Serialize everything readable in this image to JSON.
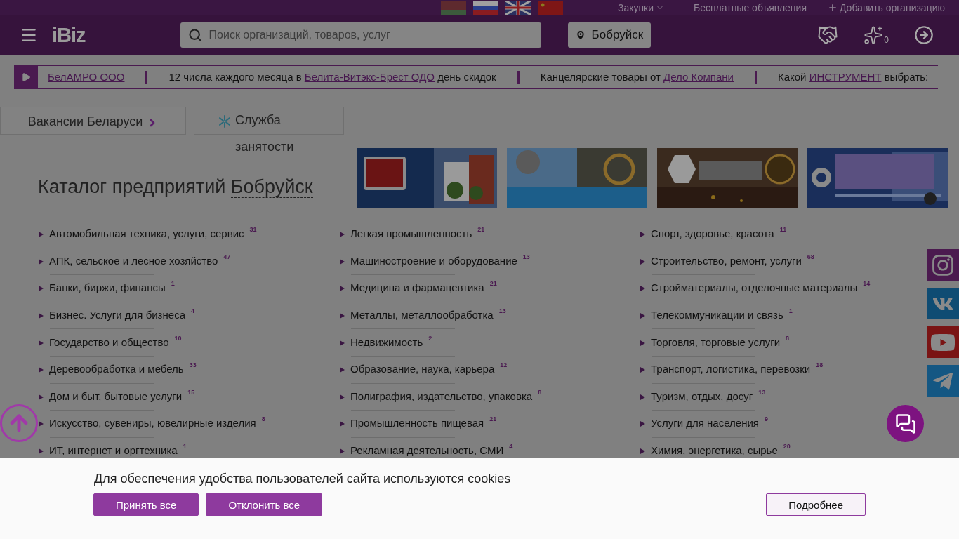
{
  "top_bar": {
    "links": [
      {
        "label": "Закупки",
        "kind": "dropdown"
      },
      {
        "label": "Бесплатные объявления",
        "kind": "link"
      },
      {
        "label": "Добавить организацию",
        "kind": "add"
      }
    ]
  },
  "header": {
    "logo": "iBiz",
    "search": {
      "placeholder": "Поиск организаций, товаров, услуг"
    },
    "city": "Бобруйск",
    "favorites_count": "0"
  },
  "ticker": {
    "items": [
      {
        "parts": [
          {
            "kind": "link",
            "text": "БелАМРО ООО"
          }
        ]
      },
      {
        "parts": [
          {
            "kind": "text",
            "text": "12 числа каждого месяца в "
          },
          {
            "kind": "link",
            "text": "Белита-Витэкс-Брест ОДО"
          },
          {
            "kind": "text",
            "text": " день скидок"
          }
        ]
      },
      {
        "parts": [
          {
            "kind": "text",
            "text": "Канцелярские товары от "
          },
          {
            "kind": "link",
            "text": "Дело Компани"
          }
        ]
      },
      {
        "parts": [
          {
            "kind": "text",
            "text": "Какой "
          },
          {
            "kind": "link",
            "text": "ИНСТРУМЕНТ"
          },
          {
            "kind": "text",
            "text": " выбрать:"
          }
        ]
      }
    ]
  },
  "promo_buttons": [
    {
      "label": "Вакансии Беларуси",
      "kind": "vacancies"
    },
    {
      "label": "Служба занятости",
      "kind": "employment"
    }
  ],
  "catalog": {
    "title": "Каталог предприятий",
    "city": "Бобруйск"
  },
  "categories": [
    [
      {
        "label": "Автомобильная техника, услуги, сервис",
        "count": "31"
      },
      {
        "label": "АПК, сельское и лесное хозяйство",
        "count": "47"
      },
      {
        "label": "Банки, биржи, финансы",
        "count": "1"
      },
      {
        "label": "Бизнес. Услуги для бизнеса",
        "count": "4"
      },
      {
        "label": "Государство и общество",
        "count": "10"
      },
      {
        "label": "Деревообработка и мебель",
        "count": "33"
      },
      {
        "label": "Дом и быт, бытовые услуги",
        "count": "15"
      },
      {
        "label": "Искусство, сувениры, ювелирные изделия",
        "count": "8"
      },
      {
        "label": "ИТ, интернет и оргтехника",
        "count": "1"
      }
    ],
    [
      {
        "label": "Легкая промышленность",
        "count": "21"
      },
      {
        "label": "Машиностроение и оборудование",
        "count": "13"
      },
      {
        "label": "Медицина и фармацевтика",
        "count": "21"
      },
      {
        "label": "Металлы, металлообработка",
        "count": "13"
      },
      {
        "label": "Недвижимость",
        "count": "2"
      },
      {
        "label": "Образование, наука, карьера",
        "count": "12"
      },
      {
        "label": "Полиграфия, издательство, упаковка",
        "count": "8"
      },
      {
        "label": "Промышленность пищевая",
        "count": "21"
      },
      {
        "label": "Рекламная деятельность, СМИ",
        "count": "4"
      }
    ],
    [
      {
        "label": "Спорт, здоровье, красота",
        "count": "11"
      },
      {
        "label": "Строительство, ремонт, услуги",
        "count": "68"
      },
      {
        "label": "Стройматериалы, отделочные материалы",
        "count": "14"
      },
      {
        "label": "Телекоммуникации и связь",
        "count": "1"
      },
      {
        "label": "Торговля, торговые услуги",
        "count": "8"
      },
      {
        "label": "Транспорт, логистика, перевозки",
        "count": "18"
      },
      {
        "label": "Туризм, отдых, досуг",
        "count": "13"
      },
      {
        "label": "Услуги для населения",
        "count": "9"
      },
      {
        "label": "Химия, энергетика, сырье",
        "count": "20"
      }
    ]
  ],
  "social": [
    {
      "kind": "instagram"
    },
    {
      "kind": "vk"
    },
    {
      "kind": "youtube"
    },
    {
      "kind": "telegram"
    }
  ],
  "cookie_banner": {
    "text": "Для обеспечения удобства пользователей сайта используются cookies",
    "buttons": [
      {
        "label": "Принять все",
        "kind": "primary"
      },
      {
        "label": "Отклонить все",
        "kind": "primary"
      },
      {
        "label": "Подробнее",
        "kind": "outline"
      }
    ]
  }
}
